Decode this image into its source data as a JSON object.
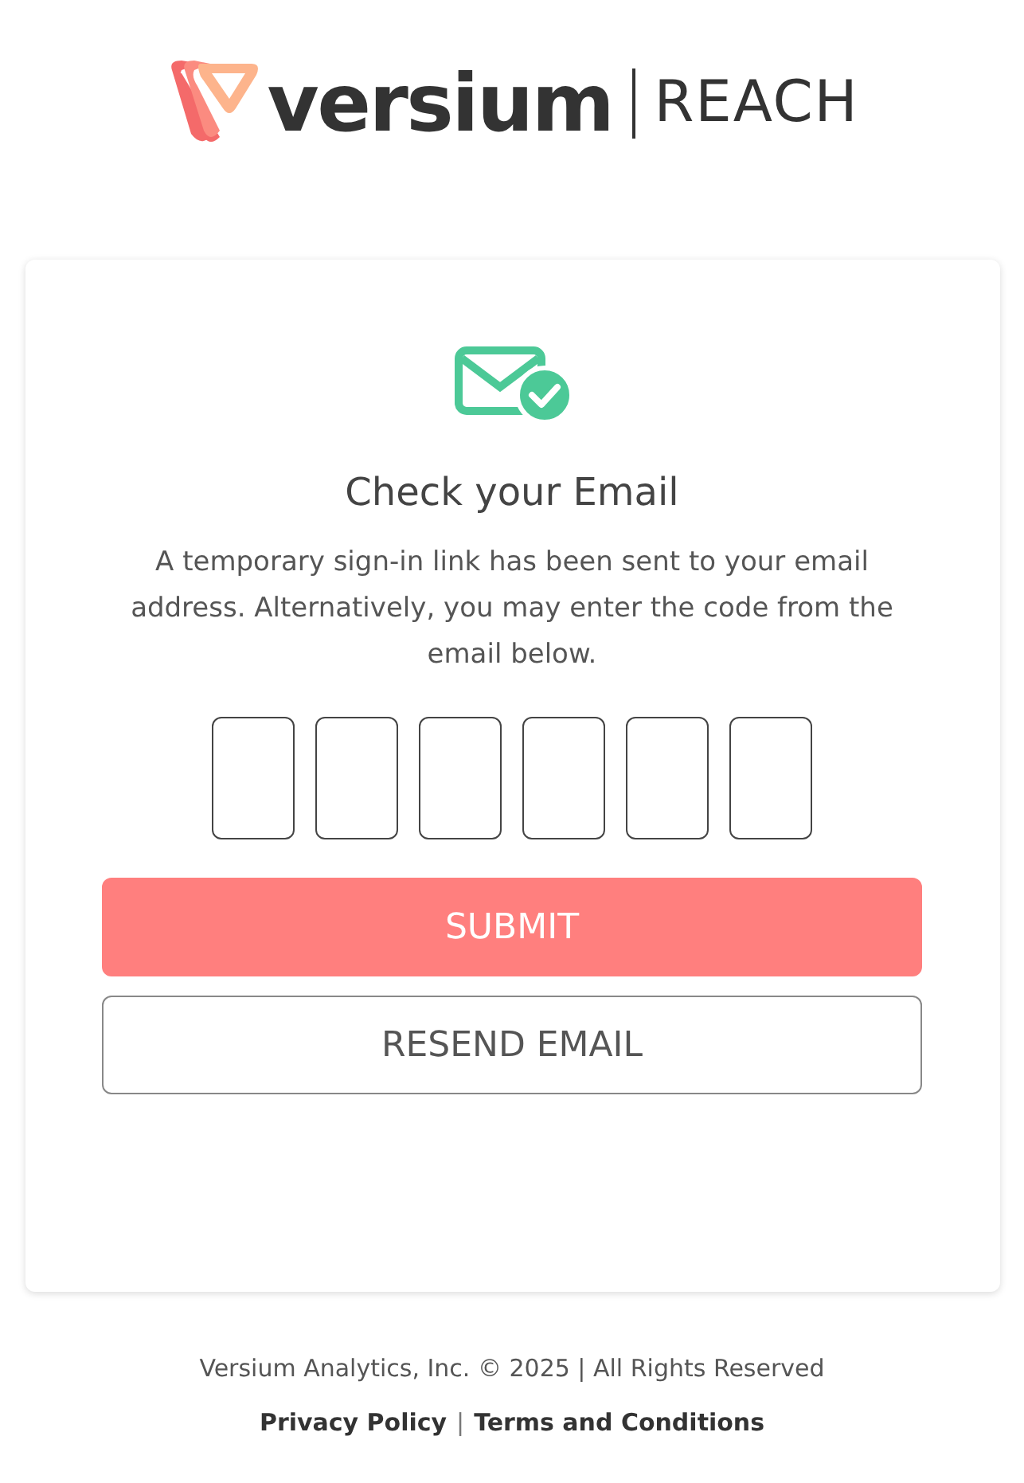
{
  "logo": {
    "brand": "versium",
    "product": "REACH"
  },
  "card": {
    "title": "Check your Email",
    "message": "A temporary sign-in link has been sent to your email address. Alternatively, you may enter the code from the email below.",
    "code_fields": [
      {
        "kind": "digit"
      },
      {
        "kind": "digit"
      },
      {
        "kind": "digit"
      },
      {
        "kind": "digit"
      },
      {
        "kind": "digit"
      },
      {
        "kind": "digit"
      }
    ],
    "buttons": [
      {
        "label": "SUBMIT",
        "kind": "primary"
      },
      {
        "label": "RESEND EMAIL",
        "kind": "outline"
      }
    ]
  },
  "footer": {
    "copyright": "Versium Analytics, Inc. © 2025 | All Rights Reserved",
    "links": [
      "Privacy Policy",
      "Terms and Conditions"
    ],
    "separator": "|"
  }
}
